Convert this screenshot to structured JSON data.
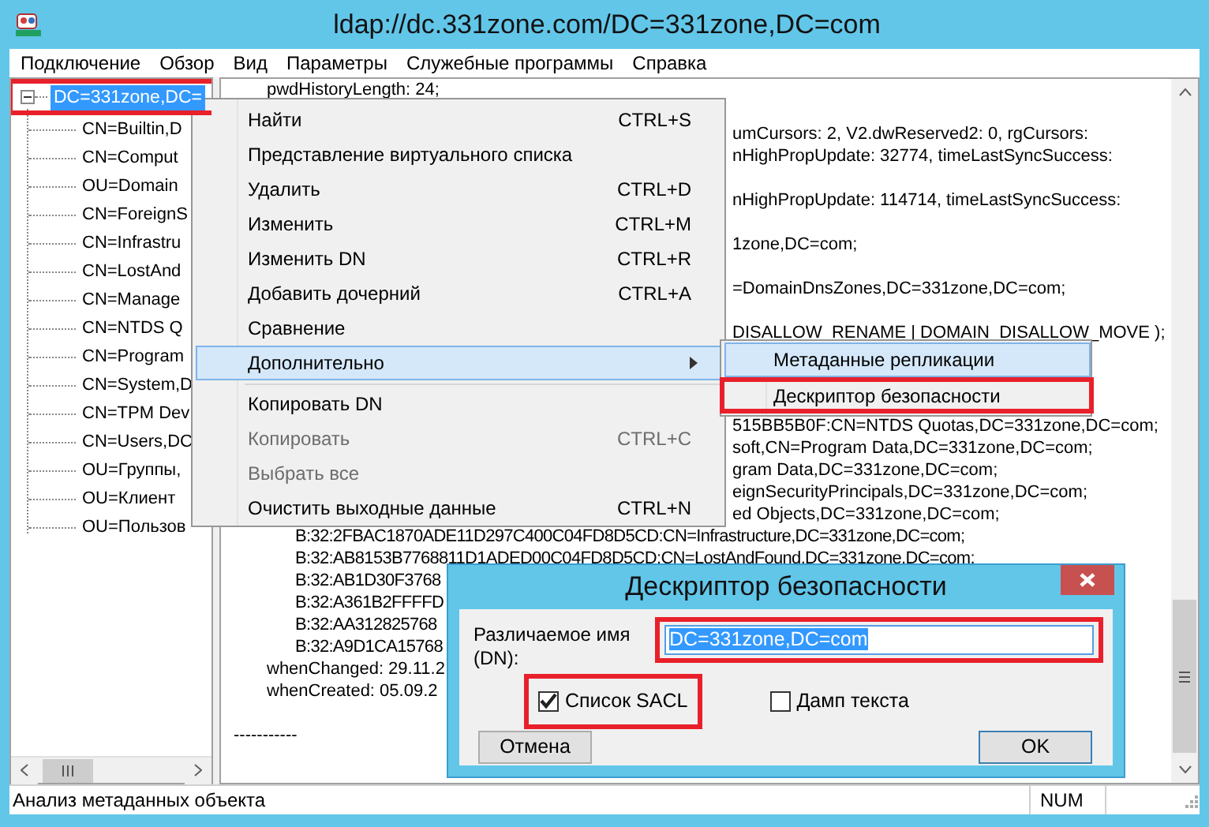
{
  "window": {
    "title": "ldap://dc.331zone.com/DC=331zone,DC=com"
  },
  "menu_bar": [
    "Подключение",
    "Обзор",
    "Вид",
    "Параметры",
    "Служебные программы",
    "Справка"
  ],
  "tree": {
    "label": "DC=331zone,DC=",
    "selected": true,
    "expanded": true,
    "highlighted": true,
    "children": [
      {
        "label": "CN=Builtin,D",
        "selected": false
      },
      {
        "label": "CN=Comput",
        "selected": false
      },
      {
        "label": "OU=Domain",
        "selected": false
      },
      {
        "label": "CN=ForeignS",
        "selected": false
      },
      {
        "label": "CN=Infrastru",
        "selected": false
      },
      {
        "label": "CN=LostAnd",
        "selected": false
      },
      {
        "label": "CN=Manage",
        "selected": false
      },
      {
        "label": "CN=NTDS Q",
        "selected": false
      },
      {
        "label": "CN=Program",
        "selected": false
      },
      {
        "label": "CN=System,D",
        "selected": false
      },
      {
        "label": "CN=TPM Dev",
        "selected": false
      },
      {
        "label": "CN=Users,DC",
        "selected": false
      },
      {
        "label": "OU=Группы,",
        "selected": false
      },
      {
        "label": "OU=Клиент",
        "selected": false
      },
      {
        "label": "OU=Пользов",
        "selected": false
      }
    ]
  },
  "output_lines": [
    {
      "kind": "attr",
      "text": "pwdHistoryLength: 24;"
    },
    {
      "kind": "tail-spaced",
      "text": "umCursors: 2, V2.dwReserved2: 0, rgCursors:"
    },
    {
      "kind": "tail",
      "text": "nHighPropUpdate: 32774, timeLastSyncSuccess:"
    },
    {
      "kind": "tail-spaced",
      "text": "nHighPropUpdate: 114714, timeLastSyncSuccess:"
    },
    {
      "kind": "tail-spaced",
      "text": "1zone,DC=com;"
    },
    {
      "kind": "tail-spaced",
      "text": "=DomainDnsZones,DC=331zone,DC=com;"
    },
    {
      "kind": "tail-spaced",
      "text": "DISALLOW_RENAME | DOMAIN_DISALLOW_MOVE );"
    },
    {
      "kind": "tail-gap",
      "text": "515BB5B0F:CN=NTDS Quotas,DC=331zone,DC=com;"
    },
    {
      "kind": "tail",
      "text": "soft,CN=Program Data,DC=331zone,DC=com;"
    },
    {
      "kind": "tail",
      "text": "gram Data,DC=331zone,DC=com;"
    },
    {
      "kind": "tail",
      "text": "eignSecurityPrincipals,DC=331zone,DC=com;"
    },
    {
      "kind": "tail",
      "text": "ed Objects,DC=331zone,DC=com;"
    },
    {
      "kind": "value",
      "text": "B:32:2FBAC1870ADE11D297C400C04FD8D5CD:CN=Infrastructure,DC=331zone,DC=com;"
    },
    {
      "kind": "value",
      "text": "B:32:AB8153B7768811D1ADED00C04FD8D5CD:CN=LostAndFound,DC=331zone,DC=com;"
    },
    {
      "kind": "value",
      "text": "B:32:AB1D30F3768"
    },
    {
      "kind": "value",
      "text": "B:32:A361B2FFFFD"
    },
    {
      "kind": "value",
      "text": "B:32:AA312825768"
    },
    {
      "kind": "value",
      "text": "B:32:A9D1CA15768"
    },
    {
      "kind": "attr",
      "text": "whenChanged: 29.11.2"
    },
    {
      "kind": "attr",
      "text": "whenCreated: 05.09.2"
    },
    {
      "kind": "rule",
      "text": "-----------"
    }
  ],
  "context_menu": [
    {
      "label": "Найти",
      "shortcut": "CTRL+S",
      "kind": "command",
      "selected": false,
      "disabled": false
    },
    {
      "label": "Представление виртуального списка",
      "kind": "command",
      "selected": false,
      "disabled": false
    },
    {
      "label": "Удалить",
      "shortcut": "CTRL+D",
      "kind": "command",
      "selected": false,
      "disabled": false
    },
    {
      "label": "Изменить",
      "shortcut": "CTRL+M",
      "kind": "command",
      "selected": false,
      "disabled": false
    },
    {
      "label": "Изменить DN",
      "shortcut": "CTRL+R",
      "kind": "command",
      "selected": false,
      "disabled": false
    },
    {
      "label": "Добавить дочерний",
      "shortcut": "CTRL+A",
      "kind": "command",
      "selected": false,
      "disabled": false
    },
    {
      "label": "Сравнение",
      "kind": "command",
      "selected": false,
      "disabled": false
    },
    {
      "label": "Дополнительно",
      "kind": "submenu",
      "selected": true,
      "disabled": false
    },
    {
      "label": "Копировать DN",
      "kind": "command",
      "selected": false,
      "disabled": false,
      "separator_before": true
    },
    {
      "label": "Копировать",
      "shortcut": "CTRL+C",
      "kind": "command",
      "selected": false,
      "disabled": true
    },
    {
      "label": "Выбрать все",
      "kind": "command",
      "selected": false,
      "disabled": true
    },
    {
      "label": "Очистить выходные данные",
      "shortcut": "CTRL+N",
      "kind": "command",
      "selected": false,
      "disabled": false
    }
  ],
  "submenu": [
    {
      "label": "Метаданные репликации",
      "selected": true,
      "highlighted": false
    },
    {
      "label": "Дескриптор безопасности",
      "selected": false,
      "highlighted": true
    }
  ],
  "dialog": {
    "title": "Дескриптор безопасности",
    "dn_label": "Различаемое имя (DN):",
    "dn_value": "DC=331zone,DC=com",
    "dn_highlighted": true,
    "checkboxes": [
      {
        "label": "Список SACL",
        "checked": true,
        "highlighted": true
      },
      {
        "label": "Дамп текста",
        "checked": false,
        "highlighted": false
      }
    ],
    "buttons": [
      {
        "label": "Отмена",
        "default": false
      },
      {
        "label": "OK",
        "default": true
      }
    ]
  },
  "status_bar": {
    "message": "Анализ метаданных объекта",
    "indicator": "NUM"
  }
}
